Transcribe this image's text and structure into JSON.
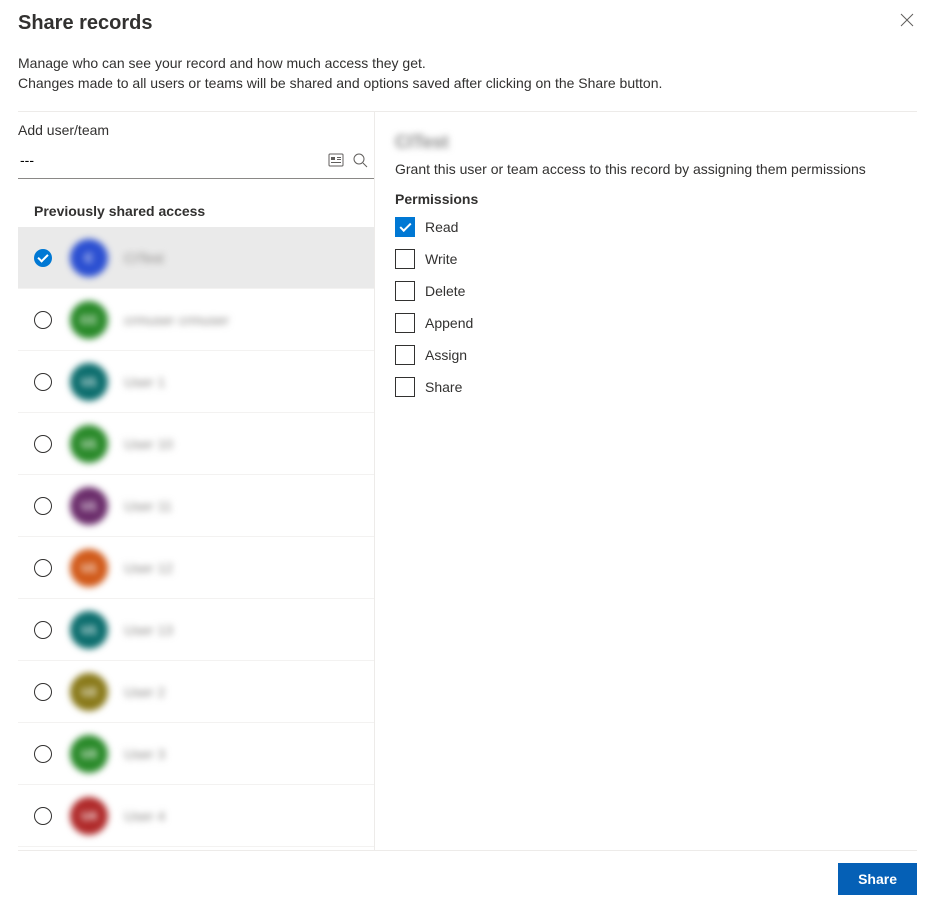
{
  "title": "Share records",
  "description_line1": "Manage who can see your record and how much access they get.",
  "description_line2": "Changes made to all users or teams will be shared and options saved after clicking on the Share button.",
  "add_label": "Add user/team",
  "search_value": "---",
  "section_header": "Previously shared access",
  "entries": [
    {
      "name": "CITest",
      "initials": "C",
      "color": "#2b4fd1",
      "selected": true
    },
    {
      "name": "crmuser crmuser",
      "initials": "CC",
      "color": "#2a8a2a",
      "selected": false
    },
    {
      "name": "User 1",
      "initials": "U1",
      "color": "#0d6e6e",
      "selected": false
    },
    {
      "name": "User 10",
      "initials": "U1",
      "color": "#2a8a2a",
      "selected": false
    },
    {
      "name": "User 11",
      "initials": "U1",
      "color": "#6b2d6b",
      "selected": false
    },
    {
      "name": "User 12",
      "initials": "U1",
      "color": "#d15a1a",
      "selected": false
    },
    {
      "name": "User 13",
      "initials": "U1",
      "color": "#0d6e6e",
      "selected": false
    },
    {
      "name": "User 2",
      "initials": "U2",
      "color": "#8a7a1a",
      "selected": false
    },
    {
      "name": "User 3",
      "initials": "U3",
      "color": "#2a8a2a",
      "selected": false
    },
    {
      "name": "User 4",
      "initials": "U4",
      "color": "#b02a2a",
      "selected": false
    }
  ],
  "right": {
    "selected_name": "CITest",
    "grant_text": "Grant this user or team access to this record by assigning them permissions",
    "permissions_label": "Permissions",
    "options": [
      {
        "label": "Read",
        "checked": true
      },
      {
        "label": "Write",
        "checked": false
      },
      {
        "label": "Delete",
        "checked": false
      },
      {
        "label": "Append",
        "checked": false
      },
      {
        "label": "Assign",
        "checked": false
      },
      {
        "label": "Share",
        "checked": false
      }
    ]
  },
  "share_button": "Share"
}
